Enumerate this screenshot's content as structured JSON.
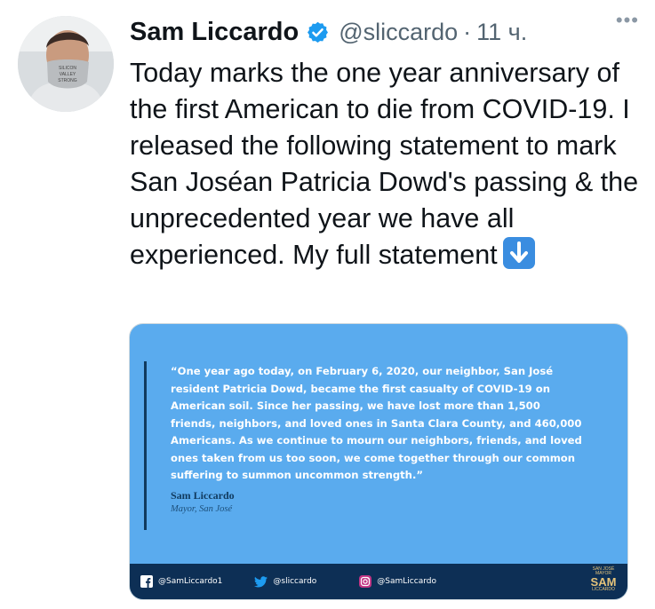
{
  "user": {
    "name": "Sam Liccardo",
    "handle": "@sliccardo",
    "time": "11 ч.",
    "separator": "·",
    "mask_text": "SILICON VALLEY STRONG"
  },
  "tweet": {
    "text": "Today marks the one year anniversary of the first American to die from COVID-19. I released the following statement to mark San Joséan Patricia Dowd's passing & the unprecedented year we have all experienced. My full statement",
    "emoji": "down-arrow-emoji"
  },
  "card": {
    "quote": "“One year ago today, on February 6, 2020, our neighbor, San José resident Patricia Dowd, became the first casualty of COVID-19 on American soil.  Since her passing, we have lost more than 1,500 friends, neighbors, and loved ones in Santa Clara County, and 460,000 Americans. As we continue to mourn our neighbors, friends, and loved ones taken from us too soon, we come together through our common suffering to summon uncommon strength.”",
    "signature_name": "Sam Liccardo",
    "signature_title": "Mayor, San José",
    "footer": {
      "facebook": "@SamLiccardo1",
      "twitter": "@sliccardo",
      "instagram": "@SamLiccardo"
    },
    "logo": {
      "top": "SAN JOSÉ MAYOR",
      "big": "SAM",
      "bottom": "LICCARDO"
    }
  },
  "colors": {
    "card_background": "#5aabee",
    "footer_background": "#0d2f55",
    "verified_blue": "#1d9bf0"
  }
}
